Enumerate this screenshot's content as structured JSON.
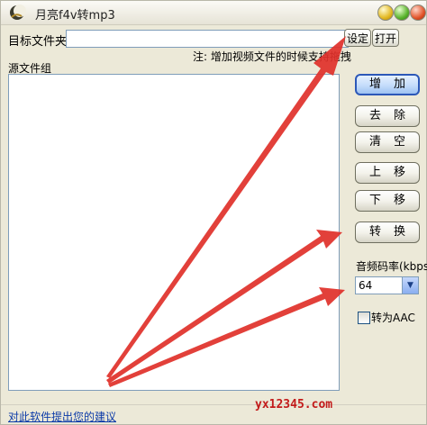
{
  "window": {
    "title": "月亮f4v转mp3"
  },
  "target": {
    "label": "目标文件夹",
    "value": "",
    "set_label": "设定",
    "open_label": "打开"
  },
  "note": "注: 增加视频文件的时候支持拖拽",
  "source": {
    "label": "源文件组",
    "files": []
  },
  "actions": {
    "add": "增加",
    "remove": "去除",
    "clear": "清空",
    "move_up": "上移",
    "move_down": "下移",
    "convert": "转换"
  },
  "bitrate": {
    "label": "音频码率(kbps)",
    "value": "64"
  },
  "aac": {
    "label": "转为AAC",
    "checked": false
  },
  "feedback_link": "对此软件提出您的建议",
  "watermark": "yx12345.com",
  "colors": {
    "annotation_arrow": "#e0302a",
    "primary_button_border": "#2c58b8"
  }
}
